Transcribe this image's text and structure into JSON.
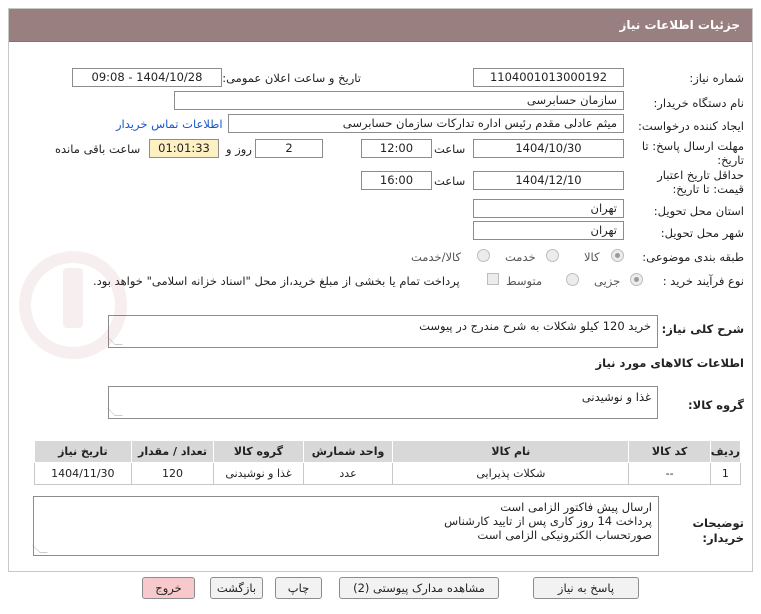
{
  "header": {
    "title": "جزئیات اطلاعات نیاز"
  },
  "form": {
    "need_number_label": "شماره نیاز:",
    "need_number": "1104001013000192",
    "announce_label": "تاریخ و ساعت اعلان عمومی:",
    "announce_value": "1404/10/28 - 09:08",
    "buyer_org_label": "نام دستگاه خریدار:",
    "buyer_org": "سازمان حسابرسی",
    "creator_label": "ایجاد کننده درخواست:",
    "creator": "میثم عادلی مقدم رئیس اداره تدارکات سازمان حسابرسی",
    "contact_link": "اطلاعات تماس خریدار",
    "deadline_label_1": "مهلت ارسال پاسخ: تا",
    "deadline_label_2": "تاریخ:",
    "deadline_date": "1404/10/30",
    "time_label": "ساعت",
    "deadline_time": "12:00",
    "days_value": "2",
    "days_and_label": "روز و",
    "remaining_time": "01:01:33",
    "remaining_label": "ساعت باقی مانده",
    "validity_label_1": "حداقل تاریخ اعتبار",
    "validity_label_2": "قیمت: تا تاریخ:",
    "validity_date": "1404/12/10",
    "validity_time_label": "ساعت",
    "validity_time": "16:00",
    "province_label": "استان محل تحویل:",
    "province": "تهران",
    "city_label": "شهر محل تحویل:",
    "city": "تهران",
    "category_label": "طبقه بندی موضوعی:",
    "category_options": [
      "کالا",
      "خدمت",
      "کالا/خدمت"
    ],
    "purchase_type_label": "نوع فرآیند خرید :",
    "purchase_options": [
      "جزیی",
      "متوسط"
    ],
    "payment_note": "پرداخت تمام یا بخشی از مبلغ خرید،از محل \"اسناد خزانه اسلامی\" خواهد بود.",
    "summary_label": "شرح کلی نیاز:",
    "summary": "خرید 120 کیلو شکلات به شرح مندرج در پیوست",
    "goods_info_title": "اطلاعات کالاهای مورد نیاز",
    "goods_group_label": "گروه کالا:",
    "goods_group": "غذا و نوشیدنی"
  },
  "table": {
    "headers": [
      "ردیف",
      "کد کالا",
      "نام کالا",
      "واحد شمارش",
      "گروه کالا",
      "تعداد / مقدار",
      "تاریخ نیاز"
    ],
    "rows": [
      [
        "1",
        "--",
        "شکلات پذیرایی",
        "عدد",
        "غذا و نوشیدنی",
        "120",
        "1404/11/30"
      ]
    ]
  },
  "buyer_notes": {
    "label_1": "توضیحات",
    "label_2": "خریدار:",
    "lines": [
      "ارسال پیش فاکتور الزامی است",
      "پرداخت 14 روز کاری پس از تایید کارشناس",
      "صورتحساب الکترونیکی الزامی است"
    ]
  },
  "buttons": {
    "reply": "پاسخ به نیاز",
    "attachments": "مشاهده مدارک پیوستی (2)",
    "print": "چاپ",
    "back": "بازگشت",
    "exit": "خروج"
  },
  "colors": {
    "title_bar": "#9a7f80",
    "table_header": "#d8d8d8",
    "remaining_bg": "#fdf0c2",
    "exit_button": "#f7c9cd",
    "link": "#1a56c9"
  }
}
